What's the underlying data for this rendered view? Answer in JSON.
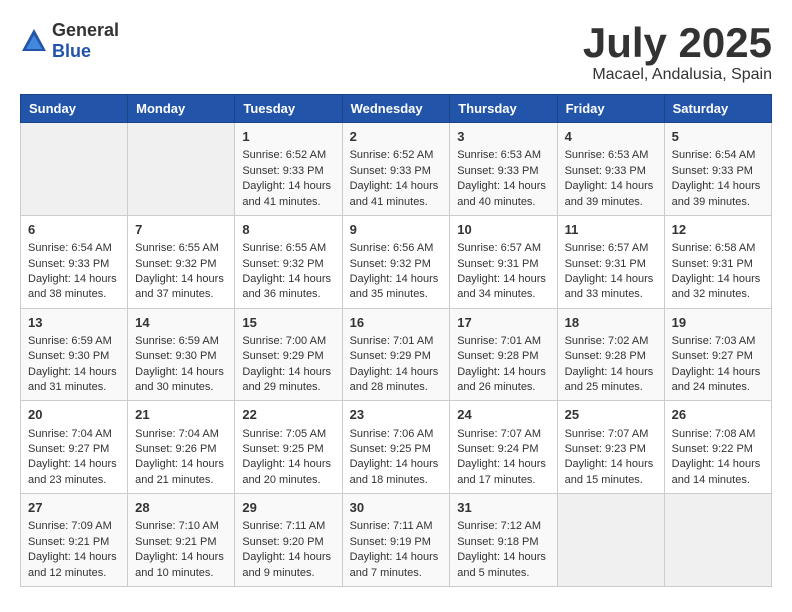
{
  "logo": {
    "general": "General",
    "blue": "Blue"
  },
  "title": "July 2025",
  "location": "Macael, Andalusia, Spain",
  "days_of_week": [
    "Sunday",
    "Monday",
    "Tuesday",
    "Wednesday",
    "Thursday",
    "Friday",
    "Saturday"
  ],
  "weeks": [
    [
      {
        "day": "",
        "sunrise": "",
        "sunset": "",
        "daylight": ""
      },
      {
        "day": "",
        "sunrise": "",
        "sunset": "",
        "daylight": ""
      },
      {
        "day": "1",
        "sunrise": "Sunrise: 6:52 AM",
        "sunset": "Sunset: 9:33 PM",
        "daylight": "Daylight: 14 hours and 41 minutes."
      },
      {
        "day": "2",
        "sunrise": "Sunrise: 6:52 AM",
        "sunset": "Sunset: 9:33 PM",
        "daylight": "Daylight: 14 hours and 41 minutes."
      },
      {
        "day": "3",
        "sunrise": "Sunrise: 6:53 AM",
        "sunset": "Sunset: 9:33 PM",
        "daylight": "Daylight: 14 hours and 40 minutes."
      },
      {
        "day": "4",
        "sunrise": "Sunrise: 6:53 AM",
        "sunset": "Sunset: 9:33 PM",
        "daylight": "Daylight: 14 hours and 39 minutes."
      },
      {
        "day": "5",
        "sunrise": "Sunrise: 6:54 AM",
        "sunset": "Sunset: 9:33 PM",
        "daylight": "Daylight: 14 hours and 39 minutes."
      }
    ],
    [
      {
        "day": "6",
        "sunrise": "Sunrise: 6:54 AM",
        "sunset": "Sunset: 9:33 PM",
        "daylight": "Daylight: 14 hours and 38 minutes."
      },
      {
        "day": "7",
        "sunrise": "Sunrise: 6:55 AM",
        "sunset": "Sunset: 9:32 PM",
        "daylight": "Daylight: 14 hours and 37 minutes."
      },
      {
        "day": "8",
        "sunrise": "Sunrise: 6:55 AM",
        "sunset": "Sunset: 9:32 PM",
        "daylight": "Daylight: 14 hours and 36 minutes."
      },
      {
        "day": "9",
        "sunrise": "Sunrise: 6:56 AM",
        "sunset": "Sunset: 9:32 PM",
        "daylight": "Daylight: 14 hours and 35 minutes."
      },
      {
        "day": "10",
        "sunrise": "Sunrise: 6:57 AM",
        "sunset": "Sunset: 9:31 PM",
        "daylight": "Daylight: 14 hours and 34 minutes."
      },
      {
        "day": "11",
        "sunrise": "Sunrise: 6:57 AM",
        "sunset": "Sunset: 9:31 PM",
        "daylight": "Daylight: 14 hours and 33 minutes."
      },
      {
        "day": "12",
        "sunrise": "Sunrise: 6:58 AM",
        "sunset": "Sunset: 9:31 PM",
        "daylight": "Daylight: 14 hours and 32 minutes."
      }
    ],
    [
      {
        "day": "13",
        "sunrise": "Sunrise: 6:59 AM",
        "sunset": "Sunset: 9:30 PM",
        "daylight": "Daylight: 14 hours and 31 minutes."
      },
      {
        "day": "14",
        "sunrise": "Sunrise: 6:59 AM",
        "sunset": "Sunset: 9:30 PM",
        "daylight": "Daylight: 14 hours and 30 minutes."
      },
      {
        "day": "15",
        "sunrise": "Sunrise: 7:00 AM",
        "sunset": "Sunset: 9:29 PM",
        "daylight": "Daylight: 14 hours and 29 minutes."
      },
      {
        "day": "16",
        "sunrise": "Sunrise: 7:01 AM",
        "sunset": "Sunset: 9:29 PM",
        "daylight": "Daylight: 14 hours and 28 minutes."
      },
      {
        "day": "17",
        "sunrise": "Sunrise: 7:01 AM",
        "sunset": "Sunset: 9:28 PM",
        "daylight": "Daylight: 14 hours and 26 minutes."
      },
      {
        "day": "18",
        "sunrise": "Sunrise: 7:02 AM",
        "sunset": "Sunset: 9:28 PM",
        "daylight": "Daylight: 14 hours and 25 minutes."
      },
      {
        "day": "19",
        "sunrise": "Sunrise: 7:03 AM",
        "sunset": "Sunset: 9:27 PM",
        "daylight": "Daylight: 14 hours and 24 minutes."
      }
    ],
    [
      {
        "day": "20",
        "sunrise": "Sunrise: 7:04 AM",
        "sunset": "Sunset: 9:27 PM",
        "daylight": "Daylight: 14 hours and 23 minutes."
      },
      {
        "day": "21",
        "sunrise": "Sunrise: 7:04 AM",
        "sunset": "Sunset: 9:26 PM",
        "daylight": "Daylight: 14 hours and 21 minutes."
      },
      {
        "day": "22",
        "sunrise": "Sunrise: 7:05 AM",
        "sunset": "Sunset: 9:25 PM",
        "daylight": "Daylight: 14 hours and 20 minutes."
      },
      {
        "day": "23",
        "sunrise": "Sunrise: 7:06 AM",
        "sunset": "Sunset: 9:25 PM",
        "daylight": "Daylight: 14 hours and 18 minutes."
      },
      {
        "day": "24",
        "sunrise": "Sunrise: 7:07 AM",
        "sunset": "Sunset: 9:24 PM",
        "daylight": "Daylight: 14 hours and 17 minutes."
      },
      {
        "day": "25",
        "sunrise": "Sunrise: 7:07 AM",
        "sunset": "Sunset: 9:23 PM",
        "daylight": "Daylight: 14 hours and 15 minutes."
      },
      {
        "day": "26",
        "sunrise": "Sunrise: 7:08 AM",
        "sunset": "Sunset: 9:22 PM",
        "daylight": "Daylight: 14 hours and 14 minutes."
      }
    ],
    [
      {
        "day": "27",
        "sunrise": "Sunrise: 7:09 AM",
        "sunset": "Sunset: 9:21 PM",
        "daylight": "Daylight: 14 hours and 12 minutes."
      },
      {
        "day": "28",
        "sunrise": "Sunrise: 7:10 AM",
        "sunset": "Sunset: 9:21 PM",
        "daylight": "Daylight: 14 hours and 10 minutes."
      },
      {
        "day": "29",
        "sunrise": "Sunrise: 7:11 AM",
        "sunset": "Sunset: 9:20 PM",
        "daylight": "Daylight: 14 hours and 9 minutes."
      },
      {
        "day": "30",
        "sunrise": "Sunrise: 7:11 AM",
        "sunset": "Sunset: 9:19 PM",
        "daylight": "Daylight: 14 hours and 7 minutes."
      },
      {
        "day": "31",
        "sunrise": "Sunrise: 7:12 AM",
        "sunset": "Sunset: 9:18 PM",
        "daylight": "Daylight: 14 hours and 5 minutes."
      },
      {
        "day": "",
        "sunrise": "",
        "sunset": "",
        "daylight": ""
      },
      {
        "day": "",
        "sunrise": "",
        "sunset": "",
        "daylight": ""
      }
    ]
  ]
}
